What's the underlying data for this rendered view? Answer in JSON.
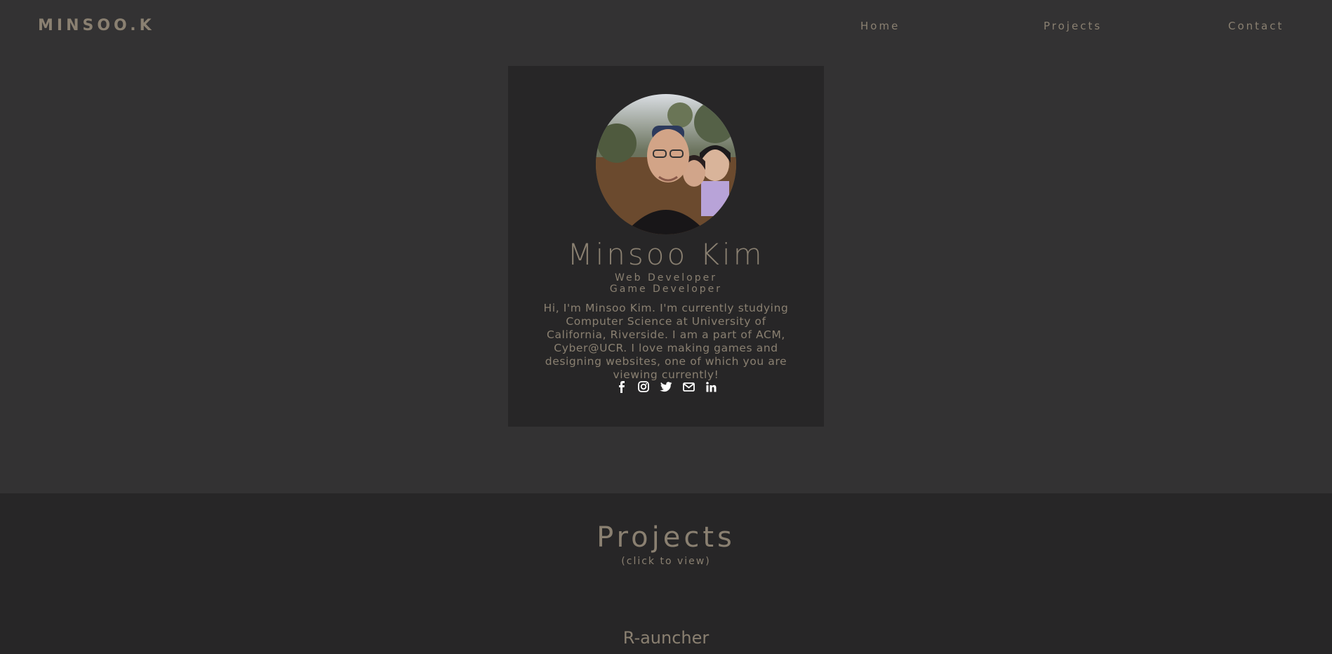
{
  "nav": {
    "brand": "MINSOO.K",
    "links": [
      "Home",
      "Projects",
      "Contact"
    ]
  },
  "profile": {
    "name": "Minsoo Kim",
    "roles": [
      "Web Developer",
      "Game Developer"
    ],
    "bio": "Hi, I'm Minsoo Kim. I'm currently studying Computer Science at University of California, Riverside. I am a part of ACM, Cyber@UCR. I love making games and designing websites, one of which you are viewing currently!",
    "socials": [
      "facebook-icon",
      "instagram-icon",
      "twitter-icon",
      "email-icon",
      "linkedin-icon"
    ]
  },
  "projects": {
    "title": "Projects",
    "subtitle": "(click to view)",
    "items": [
      {
        "name": "R-auncher"
      }
    ]
  },
  "colors": {
    "background": "#333233",
    "card": "#272627",
    "text": "#8a8071",
    "icon": "#ffffff"
  }
}
